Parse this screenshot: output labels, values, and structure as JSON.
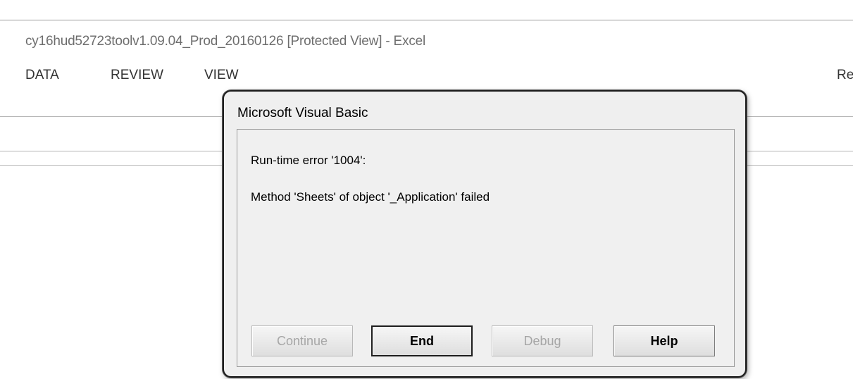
{
  "window": {
    "title": "cy16hud52723toolv1.09.04_Prod_20160126  [Protected View] - Excel"
  },
  "ribbon": {
    "tabs": [
      {
        "label": "DATA"
      },
      {
        "label": "REVIEW"
      },
      {
        "label": "VIEW"
      },
      {
        "label": "Re"
      }
    ]
  },
  "dialog": {
    "title": "Microsoft Visual Basic",
    "message_line1": "Run-time error '1004':",
    "message_line2": "Method 'Sheets' of object '_Application' failed",
    "buttons": {
      "continue": "Continue",
      "end": "End",
      "debug": "Debug",
      "help": "Help"
    },
    "button_states": {
      "continue": "disabled",
      "end": "default",
      "debug": "disabled",
      "help": "enabled"
    }
  },
  "colors": {
    "dialog_background": "#efefef",
    "disabled_text": "#a6a6a6",
    "window_title_text": "#6e6e6e"
  }
}
